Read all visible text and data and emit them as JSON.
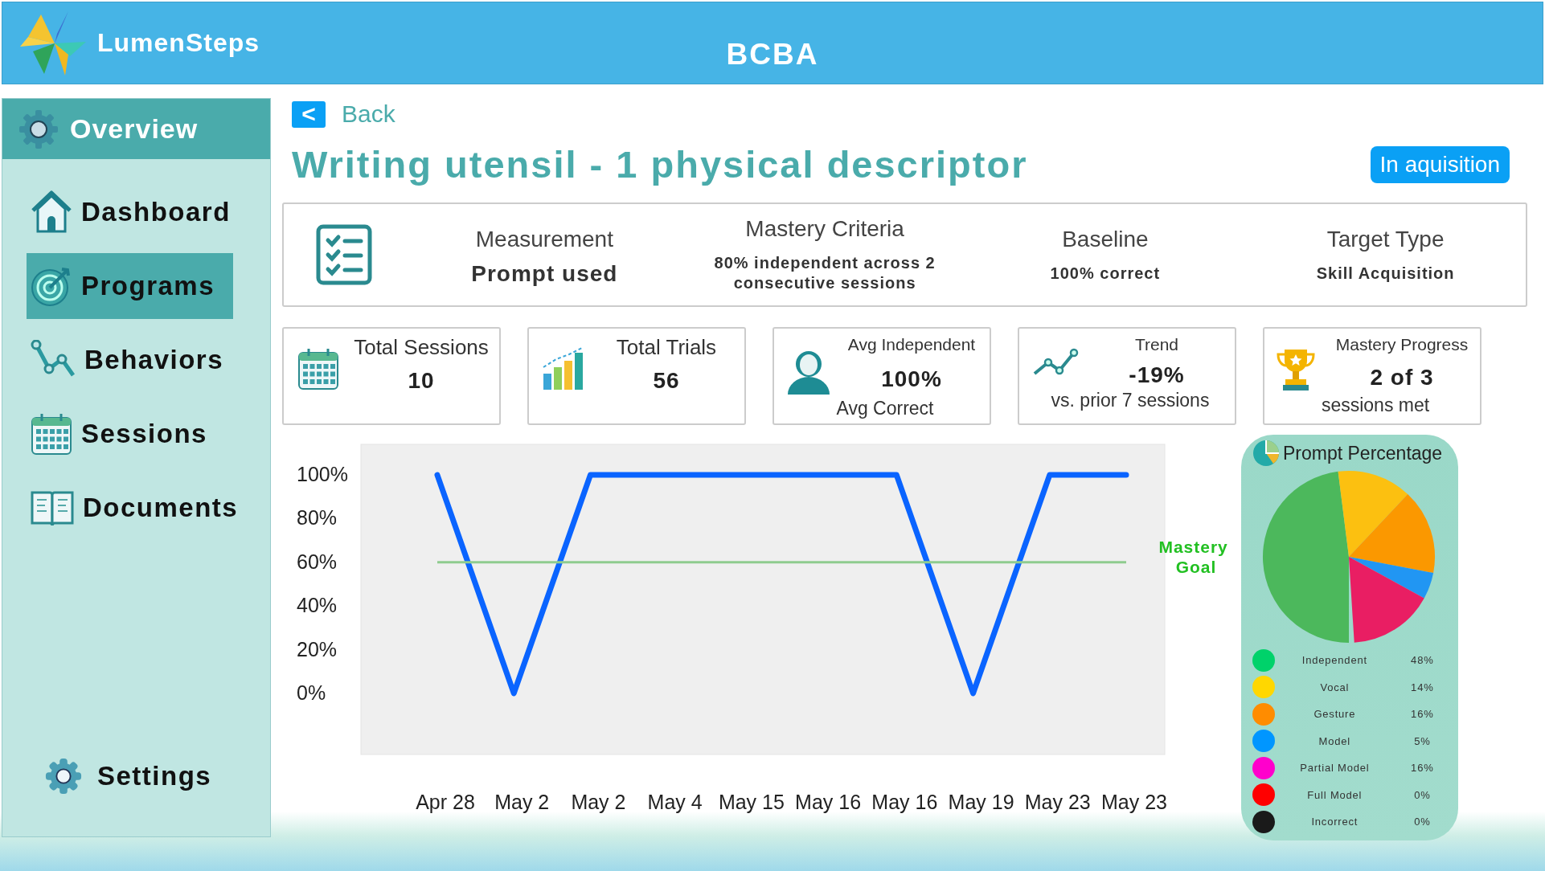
{
  "header": {
    "brand": "LumenSteps",
    "title": "BCBA"
  },
  "sidebar": {
    "section": "Overview",
    "items": [
      {
        "label": "Dashboard",
        "selected": false
      },
      {
        "label": "Programs",
        "selected": true
      },
      {
        "label": "Behaviors",
        "selected": false
      },
      {
        "label": "Sessions",
        "selected": false
      },
      {
        "label": "Documents",
        "selected": false
      }
    ],
    "settings": "Settings"
  },
  "back": {
    "icon": "<",
    "label": "Back"
  },
  "program": {
    "title": "Writing utensil - 1 physical descriptor",
    "status": "In aquisition"
  },
  "details": [
    {
      "label": "Measurement",
      "value": "Prompt used",
      "emphasis": true
    },
    {
      "label": "Mastery Criteria",
      "value": "80% independent across 2 consecutive sessions",
      "emphasis": false
    },
    {
      "label": "Baseline",
      "value": "100% correct",
      "emphasis": false
    },
    {
      "label": "Target Type",
      "value": "Skill Acquisition",
      "emphasis": false
    }
  ],
  "stats": [
    {
      "kind": "calendar",
      "title": "Total Sessions",
      "value": "10"
    },
    {
      "kind": "bars",
      "title": "Total Trials",
      "value": "56"
    },
    {
      "kind": "person",
      "title": "Avg Independent",
      "value": "100%",
      "note": "Avg Correct"
    },
    {
      "kind": "trend",
      "title": "Trend",
      "value": "-19%",
      "note": "vs. prior 7 sessions"
    },
    {
      "kind": "trophy",
      "title": "Mastery Progress",
      "value": "2 of 3",
      "note": "sessions met"
    }
  ],
  "progress_chart": {
    "chart_data": {
      "type": "line",
      "categories": [
        "Apr 28",
        "May 2",
        "May 2",
        "May 4",
        "May 15",
        "May 16",
        "May 16",
        "May 19",
        "May 23",
        "May 23"
      ],
      "series": [
        {
          "color": "#0a64ff",
          "values": [
            100,
            0,
            100,
            100,
            100,
            100,
            100,
            0,
            100,
            100
          ]
        },
        {
          "name": "Mastery Goal",
          "color": "#8fcc8f",
          "values": [
            60,
            60,
            60,
            60,
            60,
            60,
            60,
            60,
            60,
            60
          ]
        }
      ],
      "ylim": [
        -28,
        114
      ],
      "yticks": [
        {
          "value": 0,
          "label": "0%"
        },
        {
          "value": 20,
          "label": "20%"
        },
        {
          "value": 40,
          "label": "40%"
        },
        {
          "value": 60,
          "label": "60%"
        },
        {
          "value": 80,
          "label": "80%"
        },
        {
          "value": 100,
          "label": "100%"
        }
      ]
    }
  },
  "prompt_panel": {
    "title": "Prompt Percentage",
    "chart_data": {
      "type": "pie",
      "categories": [
        "Independent",
        "Vocal",
        "Gesture",
        "Model",
        "Partial Model",
        "Full Model",
        "Incorrect"
      ],
      "values": [
        48,
        14,
        16,
        5,
        16,
        0,
        0
      ],
      "colors": [
        "#4cb85c",
        "#fcc010",
        "#fb9800",
        "#2196f3",
        "#e91e63",
        "#ff0000",
        "#1a1a1a"
      ]
    },
    "legend": [
      {
        "percent": "48%",
        "color": "#00d26a"
      },
      {
        "percent": "14%",
        "color": "#ffd700"
      },
      {
        "percent": "16%",
        "color": "#ff8c00"
      },
      {
        "percent": "5%",
        "color": "#0096ff"
      },
      {
        "percent": "16%",
        "color": "#ff00cc"
      },
      {
        "percent": "0%",
        "color": "#ff0000"
      },
      {
        "percent": "0%",
        "color": "#1a1a1a"
      }
    ]
  }
}
